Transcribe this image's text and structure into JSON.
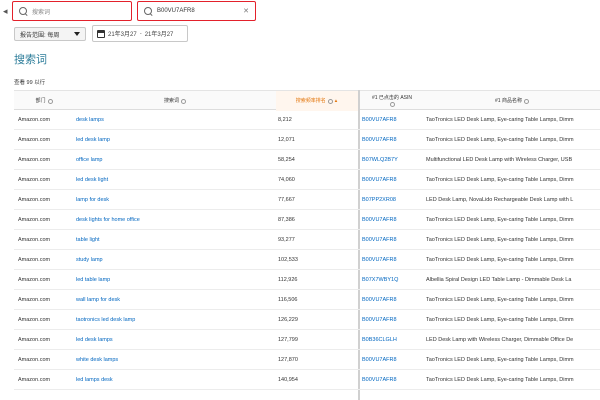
{
  "nav": {
    "back_arrow": "◂"
  },
  "search": {
    "term_placeholder": "搜索词",
    "asin_value": "B00VU7AFR8",
    "clear_symbol": "✕"
  },
  "filters": {
    "period_label": "报告范围: 每周",
    "date_start": "21年3月27",
    "date_separator": "-",
    "date_end": "21年3月27"
  },
  "section": {
    "title": "搜索词",
    "result_count": "查看 99 以行"
  },
  "table": {
    "headers": {
      "department": "部门",
      "search_term": "搜索词",
      "search_rank": "搜索频率排名",
      "asin_title": "#1 已点击的 ASIN",
      "product_name": "#1 商品名称"
    },
    "sort_indicator": "▲",
    "rows": [
      {
        "department": "Amazon.com",
        "search_term": "desk lamps",
        "rank": "8,212",
        "asin": "B00VU7AFR8",
        "product": "TaoTronics LED Desk Lamp, Eye-caring Table Lamps, Dimm"
      },
      {
        "department": "Amazon.com",
        "search_term": "led desk lamp",
        "rank": "12,071",
        "asin": "B00VU7AFR8",
        "product": "TaoTronics LED Desk Lamp, Eye-caring Table Lamps, Dimm"
      },
      {
        "department": "Amazon.com",
        "search_term": "office lamp",
        "rank": "58,254",
        "asin": "B07WLQ2B7Y",
        "product": "Multifunctional LED Desk Lamp with Wireless Charger, USB"
      },
      {
        "department": "Amazon.com",
        "search_term": "led desk light",
        "rank": "74,060",
        "asin": "B00VU7AFR8",
        "product": "TaoTronics LED Desk Lamp, Eye-caring Table Lamps, Dimm"
      },
      {
        "department": "Amazon.com",
        "search_term": "lamp for desk",
        "rank": "77,667",
        "asin": "B07PP2XR08",
        "product": "LED Desk Lamp, NovaLido Rechargeable Desk Lamp with L"
      },
      {
        "department": "Amazon.com",
        "search_term": "desk lights for home office",
        "rank": "87,386",
        "asin": "B00VU7AFR8",
        "product": "TaoTronics LED Desk Lamp, Eye-caring Table Lamps, Dimm"
      },
      {
        "department": "Amazon.com",
        "search_term": "table light",
        "rank": "93,277",
        "asin": "B00VU7AFR8",
        "product": "TaoTronics LED Desk Lamp, Eye-caring Table Lamps, Dimm"
      },
      {
        "department": "Amazon.com",
        "search_term": "study lamp",
        "rank": "102,533",
        "asin": "B00VU7AFR8",
        "product": "TaoTronics LED Desk Lamp, Eye-caring Table Lamps, Dimm"
      },
      {
        "department": "Amazon.com",
        "search_term": "led table lamp",
        "rank": "112,926",
        "asin": "B07X7WBY1Q",
        "product": "Albellia Spiral Design LED Table Lamp - Dimmable Desk La"
      },
      {
        "department": "Amazon.com",
        "search_term": "wall lamp for desk",
        "rank": "116,506",
        "asin": "B00VU7AFR8",
        "product": "TaoTronics LED Desk Lamp, Eye-caring Table Lamps, Dimm"
      },
      {
        "department": "Amazon.com",
        "search_term": "taotronics led desk lamp",
        "rank": "126,229",
        "asin": "B00VU7AFR8",
        "product": "TaoTronics LED Desk Lamp, Eye-caring Table Lamps, Dimm"
      },
      {
        "department": "Amazon.com",
        "search_term": "led desk lamps",
        "rank": "127,799",
        "asin": "B0B36CLGLH",
        "product": "LED Desk Lamp with Wireless Charger, Dimmable Office De"
      },
      {
        "department": "Amazon.com",
        "search_term": "white desk lamps",
        "rank": "127,870",
        "asin": "B00VU7AFR8",
        "product": "TaoTronics LED Desk Lamp, Eye-caring Table Lamps, Dimm"
      },
      {
        "department": "Amazon.com",
        "search_term": "led lamps desk",
        "rank": "140,954",
        "asin": "B00VU7AFR8",
        "product": "TaoTronics LED Desk Lamp, Eye-caring Table Lamps, Dimm"
      }
    ]
  },
  "colors": {
    "accent_red": "#e3212b",
    "link_blue": "#0066c0",
    "sort_orange": "#e47911",
    "title_teal": "#2d7d9a"
  }
}
